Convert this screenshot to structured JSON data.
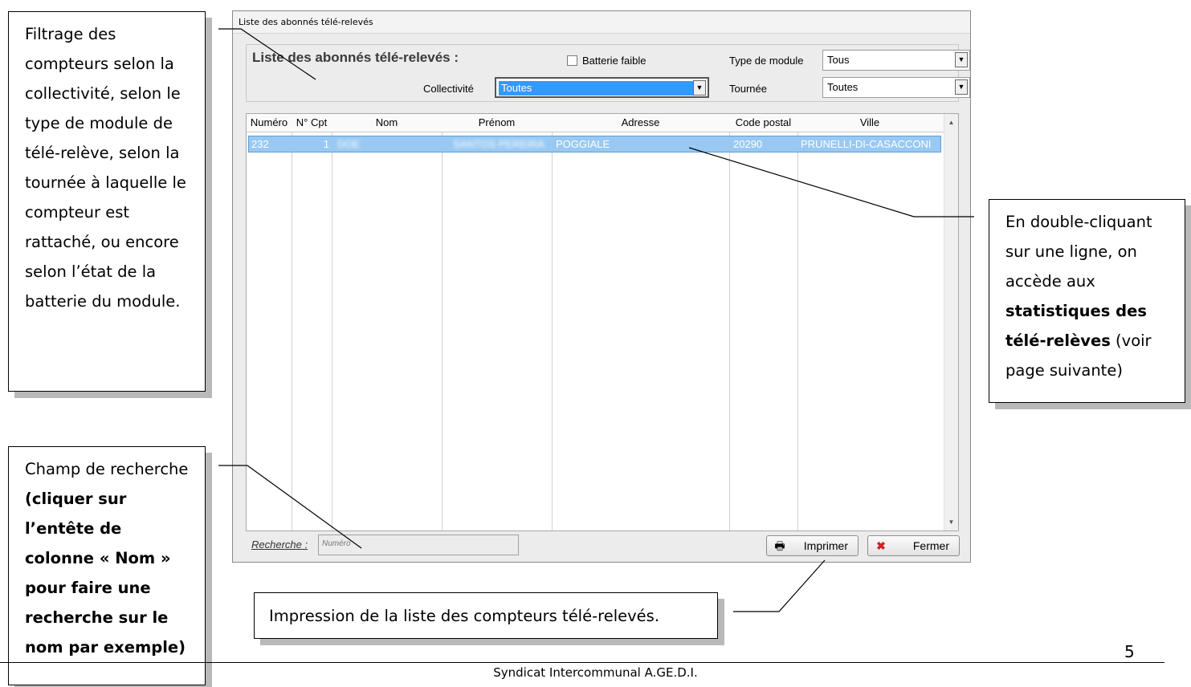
{
  "window": {
    "title": "Liste des abonnés télé-relevés",
    "panel_title": "Liste des abonnés télé-relevés :",
    "battery_checkbox": "Batterie faible",
    "collectivite_label": "Collectivité",
    "collectivite_value": "Toutes",
    "module_type_label": "Type de module",
    "module_type_value": "Tous",
    "tournee_label": "Tournée",
    "tournee_value": "Toutes",
    "columns": [
      "Numéro",
      "N° Cpt",
      "Nom",
      "Prénom",
      "Adresse",
      "Code postal",
      "Ville"
    ],
    "row": {
      "numero": "232",
      "n_cpt": "1",
      "nom": "DOE",
      "prenom": "SANTOS PEREIRA",
      "adresse": "POGGIALE",
      "code_postal": "20290",
      "ville": "PRUNELLI-DI-CASACCONI"
    },
    "search_label": "Recherche :",
    "search_placeholder": "Numéro",
    "print_button": "Imprimer",
    "close_button": "Fermer"
  },
  "callouts": {
    "filter": "Filtrage des compteurs selon la collectivité, selon le type de module de télé-relève, selon la tournée à laquelle le compteur est rattaché, ou encore selon l’état de la batterie du module.",
    "search_plain": "Champ de recherche ",
    "search_bold": "(cliquer sur l’entête de colonne « Nom » pour faire une recherche sur le nom par exemple)",
    "double_click_plain": "En double-cliquant sur une ligne, on accède aux ",
    "double_click_bold": "statistiques des télé-relèves",
    "double_click_tail": " (voir page suivante)",
    "print": "Impression de la liste des compteurs télé-relevés."
  },
  "page_number": "5",
  "footer": "Syndicat Intercommunal A.GE.D.I."
}
